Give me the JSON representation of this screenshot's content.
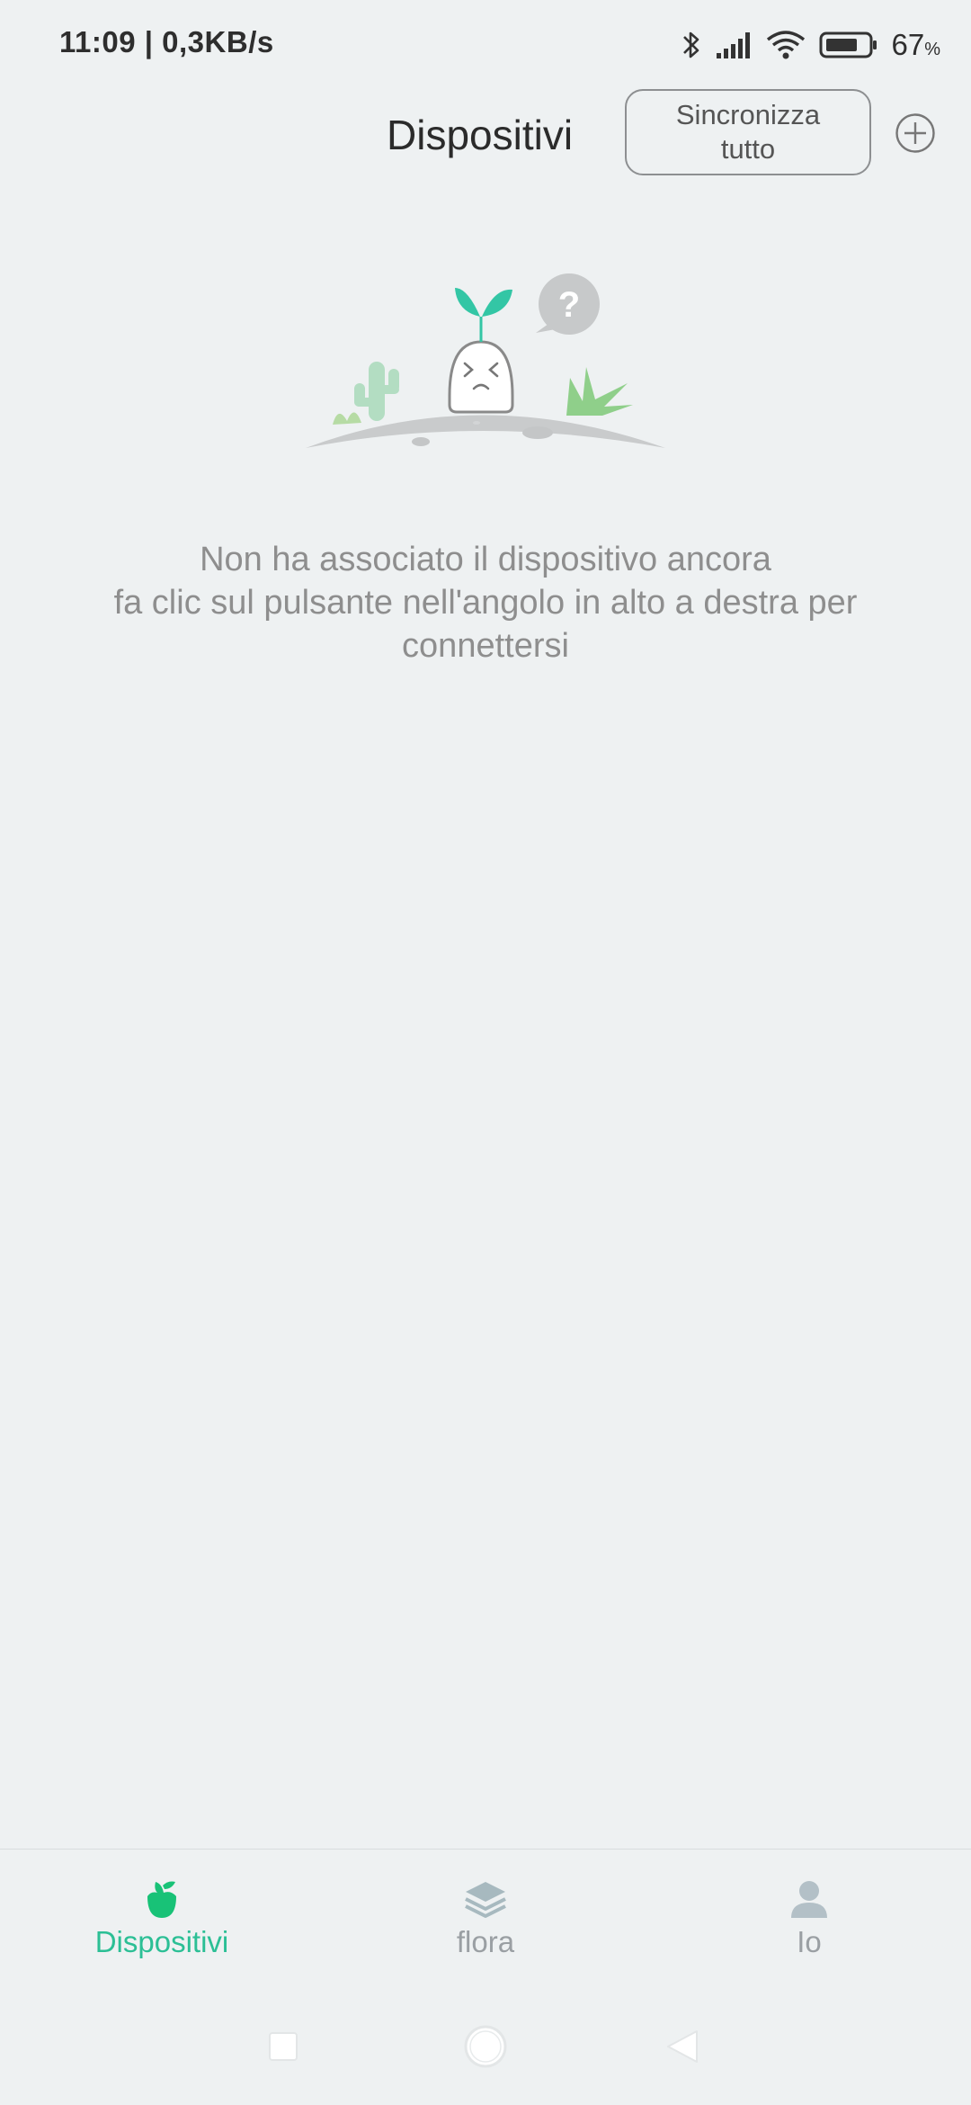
{
  "status_bar": {
    "time": "11:09 | 0,3KB/s",
    "battery_percent": "67",
    "battery_unit": "%",
    "icons": [
      "bluetooth-icon",
      "signal-icon",
      "wifi-icon",
      "battery-icon"
    ]
  },
  "header": {
    "title": "Dispositivi",
    "sync_label": "Sincronizza tutto",
    "add_icon": "plus-circle-icon"
  },
  "empty_state": {
    "illustration": "confused-sprout-illustration",
    "line1": "Non ha associato il dispositivo ancora",
    "line2": "fa clic sul pulsante nell'angolo in alto a destra per",
    "line3": "connettersi"
  },
  "bottom_nav": {
    "items": [
      {
        "label": "Dispositivi",
        "icon": "plant-icon",
        "active": true
      },
      {
        "label": "flora",
        "icon": "layers-icon",
        "active": false
      },
      {
        "label": "Io",
        "icon": "person-icon",
        "active": false
      }
    ]
  },
  "colors": {
    "accent": "#2bbf95",
    "background": "#eef1f2",
    "muted_text": "#8e8e8e"
  }
}
